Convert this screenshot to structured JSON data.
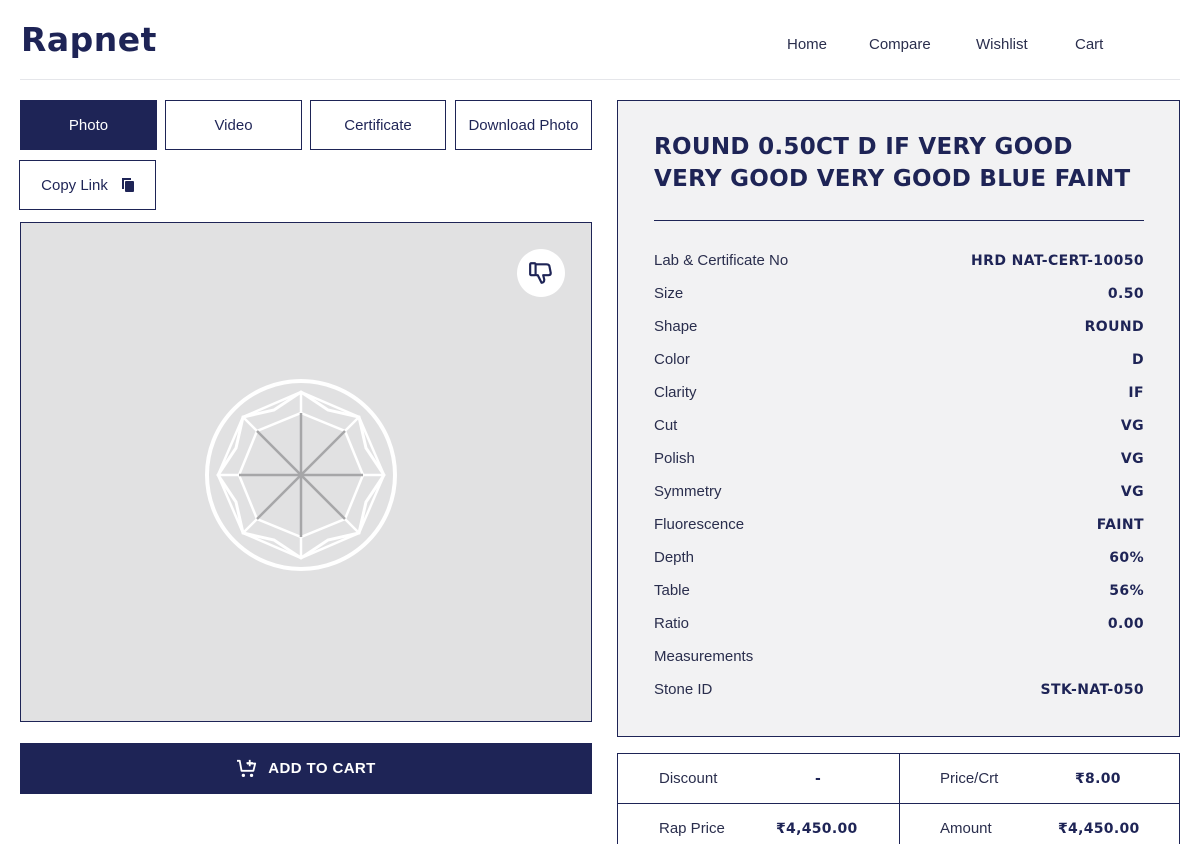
{
  "header": {
    "logo": "Rapnet",
    "nav": [
      "Home",
      "Compare",
      "Wishlist",
      "Cart"
    ]
  },
  "media_tabs": {
    "photo": "Photo",
    "video": "Video",
    "certificate": "Certificate",
    "download_photo": "Download Photo",
    "copy_link": "Copy Link"
  },
  "icons": {
    "dislike": "thumbs-down-icon",
    "copy": "copy-icon",
    "cart": "cart-plus-icon"
  },
  "actions": {
    "add_to_cart": "ADD TO CART"
  },
  "diamond": {
    "title": "ROUND 0.50CT D IF VERY GOOD VERY GOOD VERY GOOD BLUE FAINT",
    "specs": [
      {
        "label": "Lab & Certificate No",
        "value": "HRD NAT-CERT-10050"
      },
      {
        "label": "Size",
        "value": "0.50"
      },
      {
        "label": "Shape",
        "value": "ROUND"
      },
      {
        "label": "Color",
        "value": "D"
      },
      {
        "label": "Clarity",
        "value": "IF"
      },
      {
        "label": "Cut",
        "value": "VG"
      },
      {
        "label": "Polish",
        "value": "VG"
      },
      {
        "label": "Symmetry",
        "value": "VG"
      },
      {
        "label": "Fluorescence",
        "value": "FAINT"
      },
      {
        "label": "Depth",
        "value": "60%"
      },
      {
        "label": "Table",
        "value": "56%"
      },
      {
        "label": "Ratio",
        "value": "0.00"
      },
      {
        "label": "Measurements",
        "value": ""
      },
      {
        "label": "Stone ID",
        "value": "STK-NAT-050"
      }
    ]
  },
  "pricing": {
    "discount_label": "Discount",
    "discount_value": "-",
    "price_per_crt_label": "Price/Crt",
    "price_per_crt_value": "₹8.00",
    "rap_price_label": "Rap Price",
    "rap_price_value": "₹4,450.00",
    "amount_label": "Amount",
    "amount_value": "₹4,450.00"
  },
  "colors": {
    "primary": "#1e2456",
    "panel_bg": "#f2f2f3",
    "photo_bg": "#e1e1e2"
  }
}
